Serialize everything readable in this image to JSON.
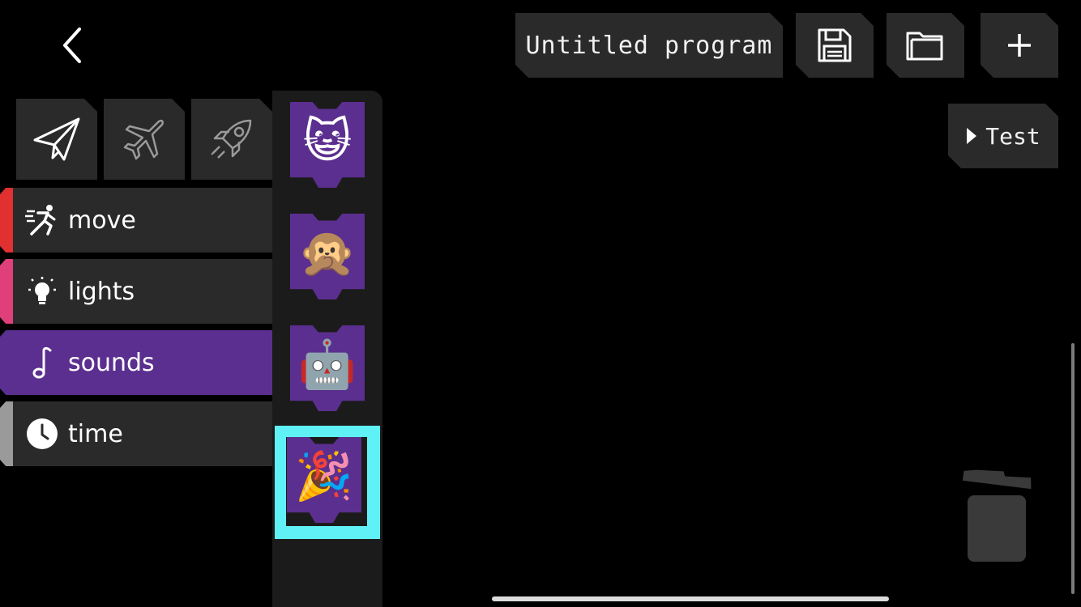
{
  "header": {
    "program_title": "Untitled program",
    "back_icon": "chevron-left-icon",
    "save_icon": "floppy-disk-icon",
    "open_icon": "folder-icon",
    "new_icon": "plus-icon"
  },
  "test_button": {
    "label": "Test",
    "icon": "play-triangle-icon"
  },
  "vehicles": [
    {
      "icon": "paper-plane-icon",
      "selected": true
    },
    {
      "icon": "airplane-icon",
      "selected": false
    },
    {
      "icon": "rocket-icon",
      "selected": false
    }
  ],
  "categories": [
    {
      "label": "move",
      "icon": "running-person-icon",
      "color": "#e03030"
    },
    {
      "label": "lights",
      "icon": "lightbulb-icon",
      "color": "#e0407a"
    },
    {
      "label": "sounds",
      "icon": "music-note-icon",
      "color": "#5b2f8f",
      "selected": true
    },
    {
      "label": "time",
      "icon": "clock-icon",
      "color": "#9a9a9a"
    }
  ],
  "blocks": [
    {
      "emoji": "😺",
      "icon": "cat-face-icon"
    },
    {
      "emoji": "🙊",
      "icon": "speak-no-evil-monkey-icon"
    },
    {
      "emoji": "🤖",
      "icon": "robot-icon"
    },
    {
      "emoji": "🎉",
      "icon": "party-popper-icon",
      "selected": true
    }
  ],
  "colors": {
    "block_purple": "#5b2f8f",
    "selection_highlight": "#5ff1f5",
    "panel": "#2a2a2a"
  },
  "trash_icon": "trash-can-icon"
}
